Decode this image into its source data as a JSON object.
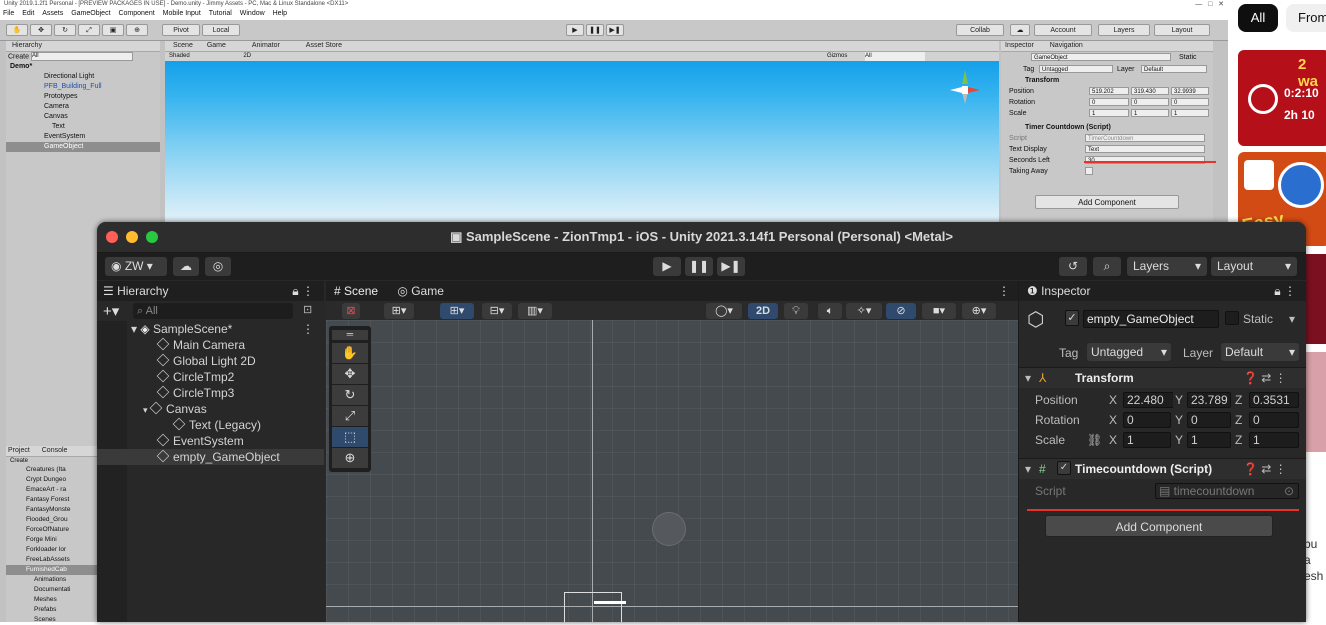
{
  "old_editor": {
    "title": "Unity 2019.1.2f1 Personal - [PREVIEW PACKAGES IN USE] - Demo.unity - Jimmy Assets - PC, Mac & Linux Standalone <DX11>",
    "menu": [
      "File",
      "Edit",
      "Assets",
      "GameObject",
      "Component",
      "Mobile Input",
      "Tutorial",
      "Window",
      "Help"
    ],
    "toolbar": {
      "pivot": "Pivot",
      "local": "Local",
      "collab": "Collab",
      "account": "Account",
      "layers": "Layers",
      "layout": "Layout"
    },
    "hierarchy": {
      "tab": "Hierarchy",
      "create": "Create",
      "search": "All",
      "scene": "Demo*",
      "items": [
        "Directional Light",
        "PFB_Building_Full",
        "Prototypes",
        "Camera",
        "Canvas",
        "Text",
        "EventSystem",
        "GameObject"
      ]
    },
    "scene_tabs": {
      "scene": "Scene",
      "game": "Game",
      "animator": "Animator",
      "asset_store": "Asset Store",
      "shaded": "Shaded",
      "mode_2d": "2D",
      "gizmos": "Gizmos",
      "search": "All"
    },
    "project": {
      "tabs": [
        "Project",
        "Console"
      ],
      "create": "Create",
      "items": [
        "Creatures (Ita",
        "Crypt Dungeo",
        "EmaceArt - ra",
        "Fantasy Forest",
        "FantasyMonste",
        "Flooded_Grou",
        "ForceOfNature",
        "Forge Mini",
        "Forkloader lor",
        "FreeLabAssets",
        "FurnishedCab",
        "Animations",
        "Documentati",
        "Meshes",
        "Prefabs",
        "Scenes"
      ]
    },
    "inspector": {
      "tabs": [
        "Inspector",
        "Navigation"
      ],
      "object_name": "GameObject",
      "static": "Static",
      "tag_label": "Tag",
      "tag": "Untagged",
      "layer_label": "Layer",
      "layer": "Default",
      "transform": "Transform",
      "position_label": "Position",
      "position": [
        "519.202",
        "319.430",
        "32.9939"
      ],
      "rotation_label": "Rotation",
      "rotation": [
        "0",
        "0",
        "0"
      ],
      "scale_label": "Scale",
      "scale": [
        "1",
        "1",
        "1"
      ],
      "component": "Timer Countdown (Script)",
      "script_label": "Script",
      "script": "TimerCountdown",
      "text_display_label": "Text Display",
      "text_display": "Text",
      "seconds_left_label": "Seconds Left",
      "seconds_left": "30",
      "taking_away_label": "Taking Away",
      "add_component": "Add Component"
    }
  },
  "browser_side": {
    "chip_all": "All",
    "chip_from": "From",
    "thumb1_line1": "2 wa",
    "thumb1_line2": "0:2:10",
    "thumb1_line3": "2h 10",
    "thumb2_text": "Easy",
    "snippet": "bu a\nesh"
  },
  "dark_editor": {
    "title": "SampleScene - ZionTmp1 - iOS - Unity 2021.3.14f1 Personal (Personal) <Metal>",
    "account": "ZW",
    "layers": "Layers",
    "layout": "Layout",
    "hierarchy": {
      "tab": "Hierarchy",
      "search": "All",
      "scene": "SampleScene*",
      "items": [
        "Main Camera",
        "Global Light 2D",
        "CircleTmp2",
        "CircleTmp3",
        "Canvas",
        "Text (Legacy)",
        "EventSystem",
        "empty_GameObject"
      ]
    },
    "scene_tabs": {
      "scene": "Scene",
      "game": "Game",
      "mode_2d": "2D"
    },
    "inspector": {
      "tab": "Inspector",
      "object_name": "empty_GameObject",
      "static": "Static",
      "tag_label": "Tag",
      "tag": "Untagged",
      "layer_label": "Layer",
      "layer": "Default",
      "transform": "Transform",
      "position_label": "Position",
      "position": [
        "22.480",
        "23.789",
        "0.3531"
      ],
      "rotation_label": "Rotation",
      "rotation": [
        "0",
        "0",
        "0"
      ],
      "scale_label": "Scale",
      "scale": [
        "1",
        "1",
        "1"
      ],
      "component": "Timecountdown (Script)",
      "script_label": "Script",
      "script": "timecountdown",
      "add_component": "Add Component"
    }
  },
  "colors": {
    "annotation_red": "#e8332a",
    "unity_dark": "#282828",
    "sky_blue": "#37b4ef"
  }
}
